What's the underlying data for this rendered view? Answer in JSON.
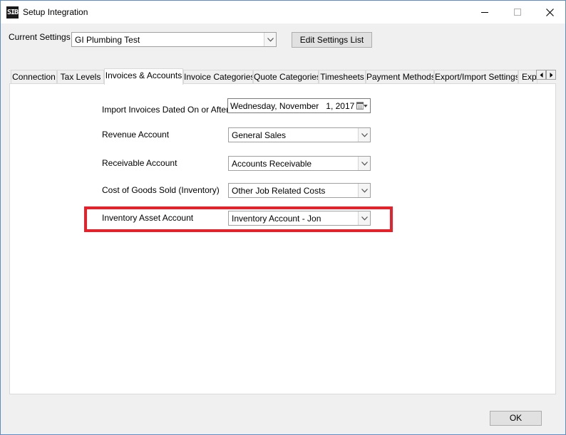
{
  "window": {
    "icon_text": "SIB",
    "title": "Setup Integration"
  },
  "current_settings": {
    "label": "Current Settings",
    "value": "GI Plumbing Test",
    "edit_button": "Edit Settings List"
  },
  "tabs": [
    {
      "label": "Connection",
      "active": false
    },
    {
      "label": "Tax Levels",
      "active": false
    },
    {
      "label": "Invoices & Accounts",
      "active": true
    },
    {
      "label": "Invoice Categories",
      "active": false
    },
    {
      "label": "Quote Categories",
      "active": false
    },
    {
      "label": "Timesheets",
      "active": false
    },
    {
      "label": "Payment Methods",
      "active": false
    },
    {
      "label": "Export/Import Settings",
      "active": false
    },
    {
      "label": "Exp",
      "active": false
    }
  ],
  "form": {
    "import_date": {
      "label": "Import Invoices Dated On or After",
      "value": "Wednesday, November   1, 2017"
    },
    "revenue": {
      "label": "Revenue Account",
      "value": "General Sales"
    },
    "receivable": {
      "label": "Receivable Account",
      "value": "Accounts Receivable"
    },
    "cogs": {
      "label": "Cost of Goods Sold (Inventory)",
      "value": "Other Job Related Costs"
    },
    "inventory_asset": {
      "label": "Inventory Asset Account",
      "value": "Inventory Account - Jon"
    }
  },
  "footer": {
    "ok_button": "OK"
  },
  "colors": {
    "highlight": "#e8202a",
    "window_border": "#5f8bc7"
  }
}
